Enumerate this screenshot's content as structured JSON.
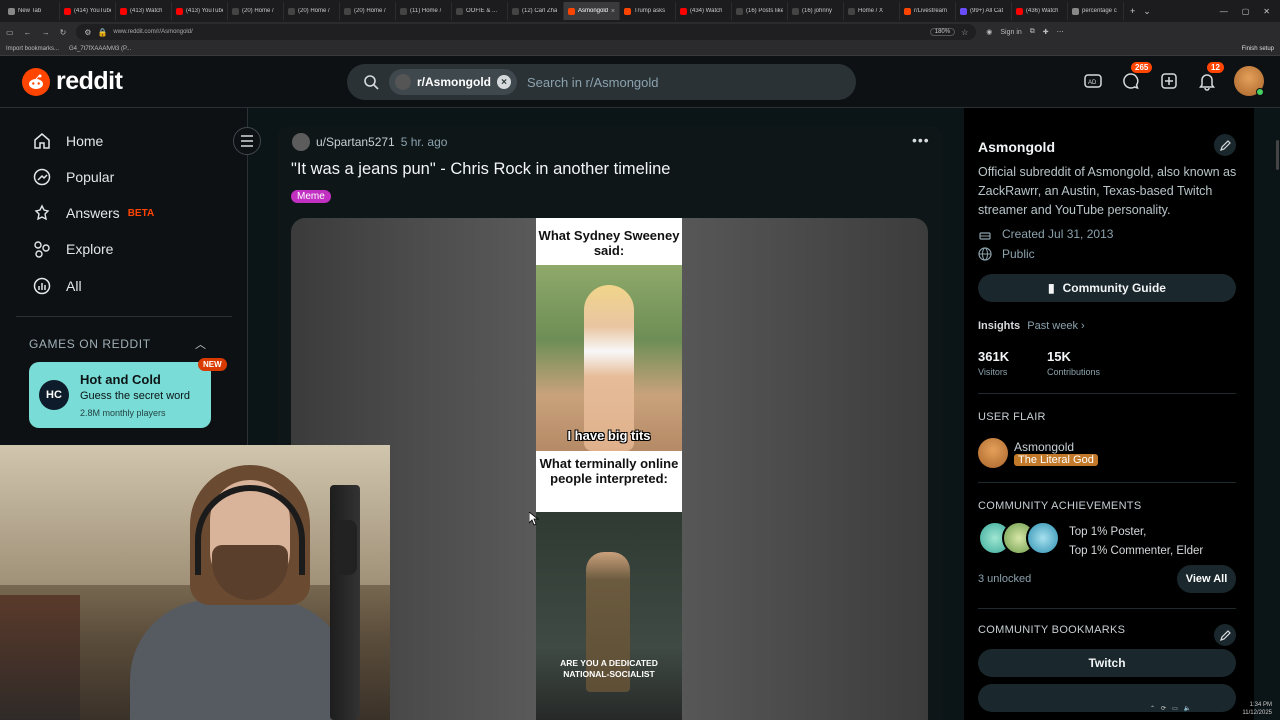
{
  "browser": {
    "tabs": [
      {
        "label": "New Tab",
        "color": "#888888"
      },
      {
        "label": "(414) YouTube",
        "color": "#ff0000"
      },
      {
        "label": "(413) Watch",
        "color": "#ff0000"
      },
      {
        "label": "(413) YouTube",
        "color": "#ff0000"
      },
      {
        "label": "(20) Home /",
        "color": "#444444"
      },
      {
        "label": "(20) Home /",
        "color": "#444444"
      },
      {
        "label": "(20) Home /",
        "color": "#444444"
      },
      {
        "label": "(11) Home /",
        "color": "#444444"
      },
      {
        "label": "OOFIE & ...",
        "color": "#444444"
      },
      {
        "label": "(12) Carl Zha",
        "color": "#444444"
      },
      {
        "label": "Asmongold",
        "color": "#ff4500",
        "active": true
      },
      {
        "label": "Trump asks",
        "color": "#ff4500"
      },
      {
        "label": "(434) Watch",
        "color": "#ff0000"
      },
      {
        "label": "(16) Posts like",
        "color": "#444444"
      },
      {
        "label": "(16) johnny",
        "color": "#444444"
      },
      {
        "label": "Home / X",
        "color": "#444444"
      },
      {
        "label": "r/Livestream",
        "color": "#ff4500"
      },
      {
        "label": "(99+) All Cat",
        "color": "#6a4cff"
      },
      {
        "label": "(436) Watch",
        "color": "#ff0000"
      },
      {
        "label": "percentage c",
        "color": "#888888"
      }
    ],
    "url": "www.reddit.com/r/Asmongold/",
    "zoom": "180%",
    "sign_in": "Sign in",
    "bookmarks": [
      "Import bookmarks...",
      "G4_7t7fXAAAfvM3 (P..."
    ],
    "finish_setup": "Finish setup"
  },
  "header": {
    "logo_text": "reddit",
    "search_chip": "r/Asmongold",
    "search_placeholder": "Search in r/Asmongold",
    "chat_badge": "265",
    "notif_badge": "12",
    "icons": [
      "ads-icon",
      "chat-icon",
      "create-icon",
      "bell-icon"
    ]
  },
  "leftnav": {
    "items": [
      {
        "label": "Home",
        "icon": "home-icon"
      },
      {
        "label": "Popular",
        "icon": "popular-icon"
      },
      {
        "label": "Answers",
        "icon": "answers-icon",
        "tag": "BETA"
      },
      {
        "label": "Explore",
        "icon": "explore-icon"
      },
      {
        "label": "All",
        "icon": "all-icon"
      }
    ],
    "games_header": "GAMES ON REDDIT",
    "game": {
      "title": "Hot and Cold",
      "subtitle": "Guess the secret word",
      "players": "2.8M monthly players",
      "badge": "NEW"
    }
  },
  "post": {
    "author": "u/Spartan5271",
    "time": "5 hr. ago",
    "title": "\"It was a jeans pun\" - Chris Rock in another timeline",
    "flair": "Meme",
    "meme": {
      "top_text": "What Sydney Sweeney said:",
      "caption1": "I have big tits",
      "mid_text": "What terminally online people interpreted:",
      "caption2": "ARE YOU A DEDICATED NATIONAL-SOCIALIST"
    }
  },
  "sidebar": {
    "name": "Asmongold",
    "description": "Official subreddit of Asmongold, also known as ZackRawrr, an Austin, Texas-based Twitch streamer and YouTube personality.",
    "created": "Created Jul 31, 2013",
    "visibility": "Public",
    "guide_button": "Community Guide",
    "insights_label": "Insights",
    "insights_period": "Past week",
    "stats": [
      {
        "value": "361K",
        "label": "Visitors"
      },
      {
        "value": "15K",
        "label": "Contributions"
      }
    ],
    "user_flair_header": "USER FLAIR",
    "flair_user": "Asmongold",
    "flair_tag": "The Literal God",
    "achievements_header": "COMMUNITY ACHIEVEMENTS",
    "achievements": [
      "Top 1% Poster,",
      "Top 1% Commenter, Elder"
    ],
    "unlocked": "3 unlocked",
    "view_all": "View All",
    "bookmarks_header": "COMMUNITY BOOKMARKS",
    "bookmark_button": "Twitch"
  },
  "taskbar": {
    "time": "1:34 PM",
    "date": "11/12/2025"
  },
  "colors": {
    "brand": "#ff4500",
    "background": "#0b1416",
    "flair": "#c230c2"
  }
}
